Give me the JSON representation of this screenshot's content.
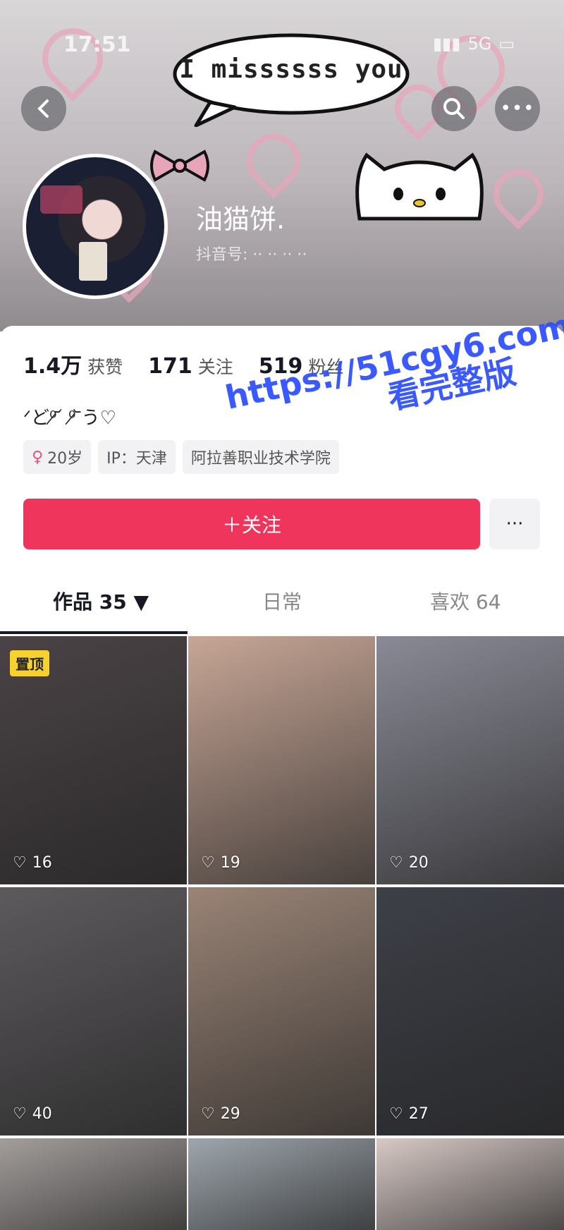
{
  "status_bar": {
    "time": "17:51",
    "network": "5G"
  },
  "banner": {
    "bubble_text": "I missssss you"
  },
  "header": {
    "back_icon": "chevron-left-icon",
    "search_icon": "search-icon",
    "more_icon": "ellipsis-icon"
  },
  "profile": {
    "nickname": "油猫饼.",
    "uid_label": "抖音号: ·· ·· ·· ··"
  },
  "stats": [
    {
      "value": "1.4万",
      "label": "获赞"
    },
    {
      "value": "171",
      "label": "关注"
    },
    {
      "value": "519",
      "label": "粉丝"
    }
  ],
  "bio": "ᐟど⁰̷ ᷄  ⁰̷ ᷅う♡",
  "tags": {
    "age": "20岁",
    "ip": "IP：天津",
    "school": "阿拉善职业技术学院"
  },
  "actions": {
    "follow_label": "＋关注",
    "more_label": "···"
  },
  "tabs": [
    {
      "label": "作品 35 ▼"
    },
    {
      "label": "日常"
    },
    {
      "label": "喜欢 64"
    }
  ],
  "videos": [
    {
      "likes": "16",
      "pinned": "置顶",
      "color": "#4a4346"
    },
    {
      "likes": "19",
      "color": "#c7a696"
    },
    {
      "likes": "20",
      "color": "#8a8a96"
    },
    {
      "likes": "40",
      "color": "#5d5a5d"
    },
    {
      "likes": "29",
      "color": "#9a8476"
    },
    {
      "likes": "27",
      "color": "#3e4048"
    },
    {
      "likes": "",
      "color": "#a39e9c"
    },
    {
      "likes": "",
      "color": "#9ea6ad"
    },
    {
      "likes": "",
      "color": "#d7c9c5"
    }
  ],
  "watermark": {
    "line1": "https://51cgy6.com",
    "line2": "看完整版"
  }
}
